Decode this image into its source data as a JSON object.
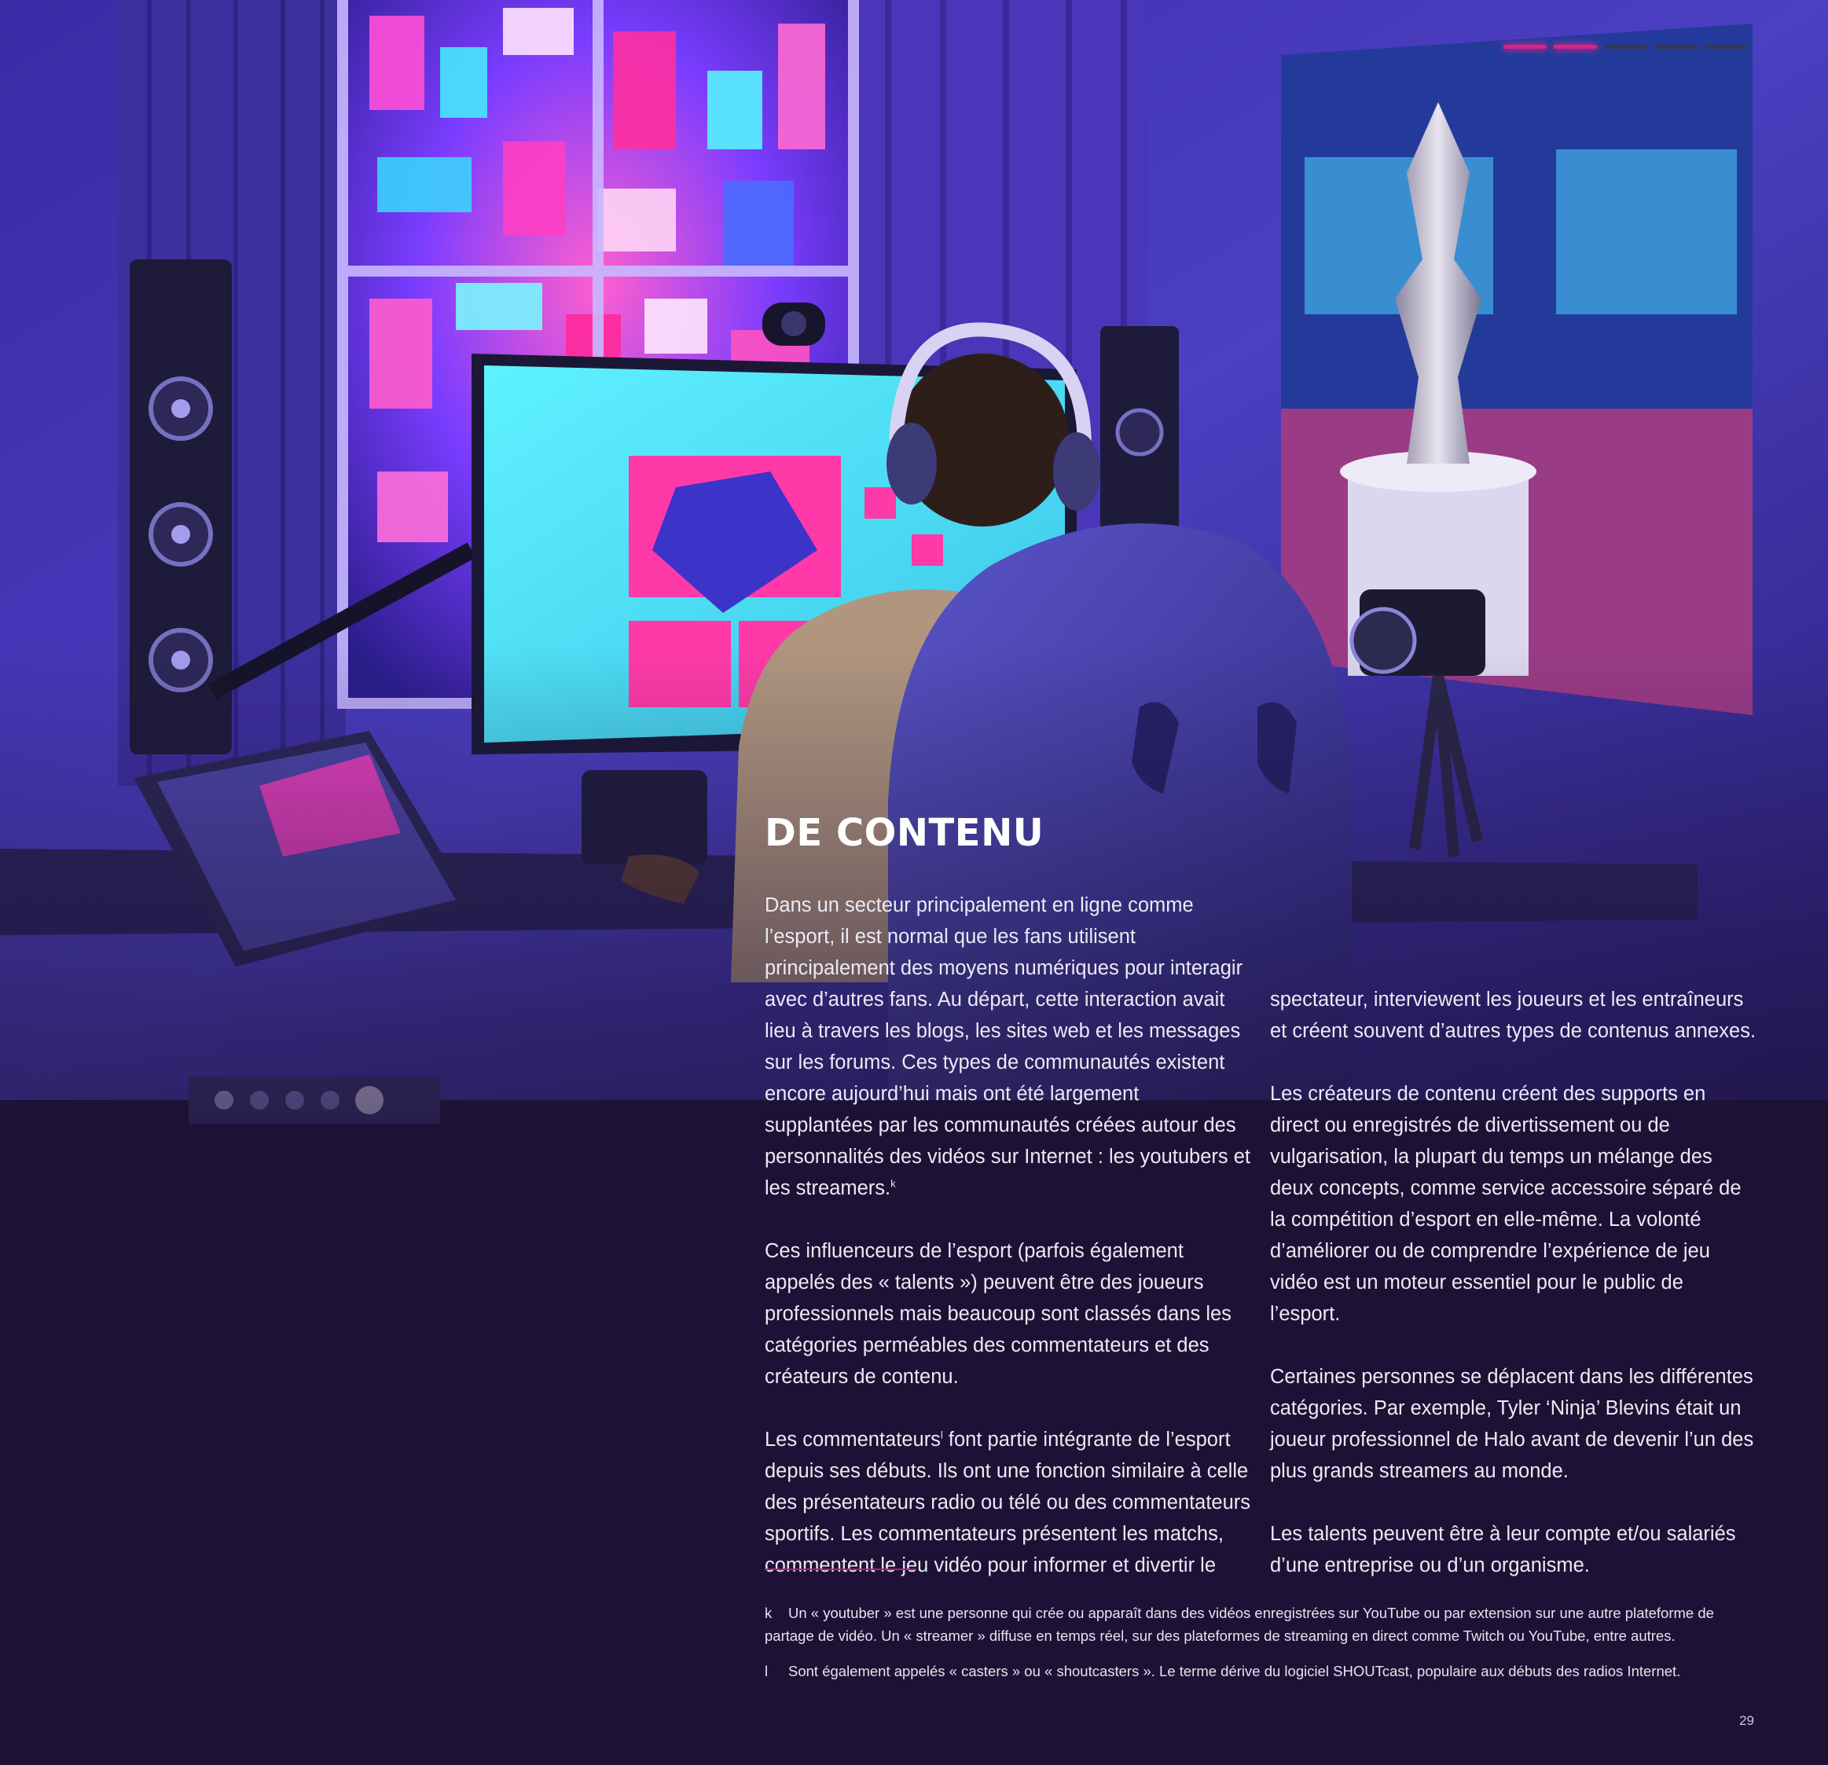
{
  "progress": {
    "total_segments": 5,
    "active_segments": 2,
    "active_color": "#e0207e",
    "inactive_color": "#3a3550"
  },
  "heading": "DE CONTENU",
  "column_left": {
    "p1": "Dans un secteur principalement en ligne comme l’esport, il est normal que les fans utilisent principalement des moyens numériques pour interagir avec d’autres fans. Au départ, cette interaction avait lieu à travers les blogs, les sites web et les messages sur les forums. Ces types de communautés existent encore aujourd’hui mais ont été largement supplantées par les communautés créées autour des personnalités des vidéos sur Internet : les youtubers et les streamers.",
    "p1_note": "k",
    "p2": "Ces influenceurs de l’esport (parfois également appelés des « talents ») peuvent être des joueurs professionnels mais beaucoup sont classés dans les catégories perméables des commentateurs et des créateurs de contenu.",
    "p3_start": "Les commentateurs",
    "p3_note": "l",
    "p3_rest": " font partie intégrante de l’esport depuis ses débuts. Ils ont une fonction similaire à celle des présentateurs radio ou télé ou des commentateurs sportifs. Les commentateurs présentent les matchs, commentent le jeu vidéo pour informer et divertir le"
  },
  "column_right": {
    "p1": "spectateur, interviewent les joueurs et les entraîneurs et créent souvent d’autres types de contenus annexes.",
    "p2": "Les créateurs de contenu créent des supports en direct ou enregistrés de divertissement ou de vulgarisation, la plupart du temps un mélange des deux concepts, comme service accessoire séparé de la compétition d’esport en elle-même. La volonté d’améliorer ou de comprendre l’expérience de jeu vidéo est un moteur essentiel pour le public de l’esport.",
    "p3": "Certaines personnes se déplacent dans les différentes catégories. Par exemple, Tyler ‘Ninja’ Blevins était un joueur professionnel de Halo avant de devenir l’un des plus grands streamers au monde.",
    "p4": "Les talents peuvent être à leur compte et/ou salariés d’une entreprise ou d’un organisme."
  },
  "footnotes": [
    {
      "mark": "k",
      "text": "Un « youtuber » est une personne qui crée ou apparaît dans des vidéos enregistrées sur YouTube ou par extension sur une autre plateforme de partage de vidéo. Un « streamer » diffuse en temps réel, sur des plateformes de streaming en direct comme Twitch ou YouTube, entre autres."
    },
    {
      "mark": "l",
      "text": "Sont également appelés « casters » ou « shoutcasters ». Le terme dérive du logiciel SHOUTcast, populaire aux débuts des radios Internet."
    }
  ],
  "page_number": "29",
  "colors": {
    "background_dark": "#1d1235",
    "neon_pink": "#ff3aa8",
    "neon_cyan": "#4fe6f0",
    "room_purple": "#4a36b8",
    "footnote_rule": "#b3206a"
  }
}
